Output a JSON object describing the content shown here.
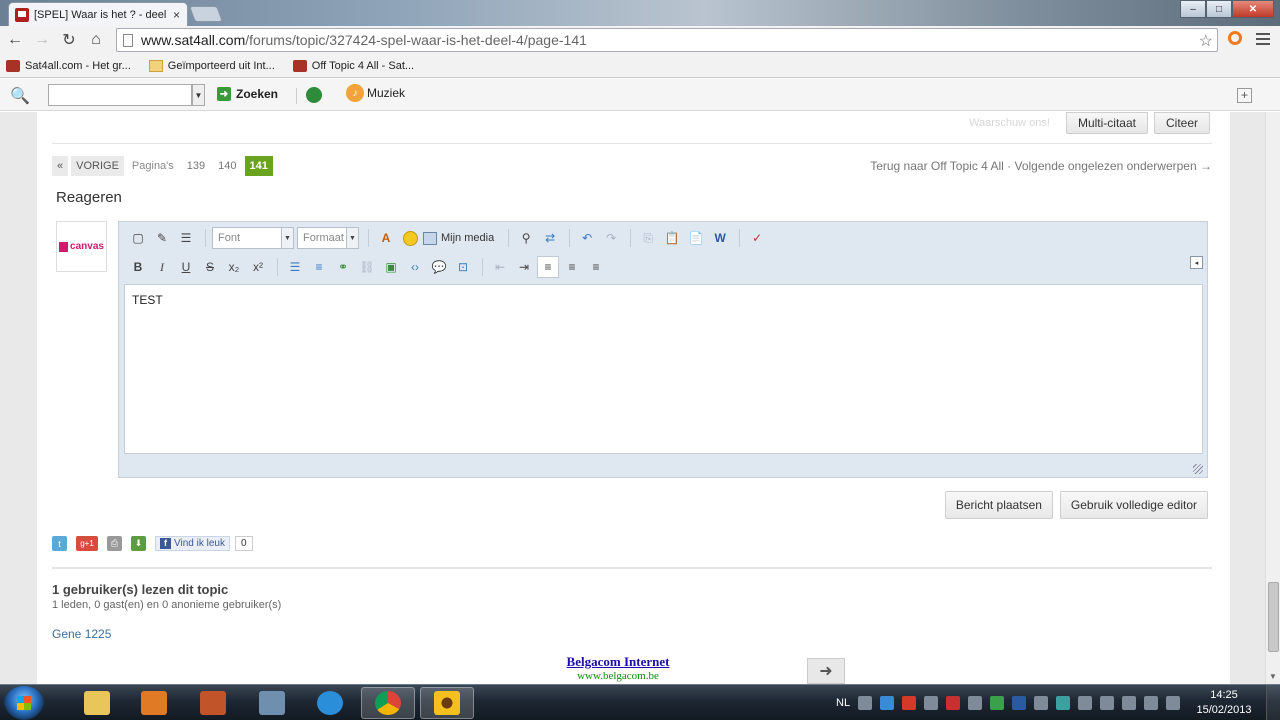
{
  "browser": {
    "tab_title": "[SPEL] Waar is het ? - deel",
    "tab_close": "×",
    "url_domain": "www.sat4all.com",
    "url_path": "/forums/topic/327424-spel-waar-is-het-deel-4/page-141",
    "window_controls": {
      "minimize": "–",
      "maximize": "□",
      "close": "✕"
    },
    "nav": {
      "back": "←",
      "forward": "→",
      "reload": "↻",
      "home": "⌂",
      "star": "☆"
    },
    "bookmarks": [
      {
        "label": "Sat4all.com - Het gr...",
        "icon": "red-tv-icon"
      },
      {
        "label": "Geïmporteerd uit Int...",
        "icon": "folder-icon"
      },
      {
        "label": "Off Topic 4 All - Sat...",
        "icon": "red-tv-icon"
      }
    ]
  },
  "searchbar": {
    "search_icon": "🔍",
    "dropdown": "▼",
    "zoeken_label": "Zoeken",
    "zoeken_arrow": "➜",
    "muziek_label": "Muziek",
    "plus": "+"
  },
  "post_actions": {
    "warn": "Waarschuw ons!",
    "multi_quote": "Multi-citaat",
    "quote": "Citeer"
  },
  "pagination": {
    "first": "«",
    "prev": "VORIGE",
    "pages_label": "Pagina's",
    "pages": [
      "139",
      "140"
    ],
    "current": "141"
  },
  "topic_nav": "Terug naar Off Topic 4 All · Volgende ongelezen onderwerpen →",
  "reply": {
    "heading": "Reageren",
    "avatar_text": "canvas",
    "font_select": "Font",
    "format_select": "Formaat",
    "mijn_media": "Mijn media",
    "text": "TEST",
    "submit": "Bericht plaatsen",
    "full_editor": "Gebruik volledige editor",
    "toolbar_row1": {
      "source": "▢",
      "eraser": "✎",
      "template": "☰",
      "font_color": "A",
      "smiley": "",
      "binoculars": "⚲",
      "replace": "⇄",
      "undo": "↶",
      "redo": "↷",
      "copy": "⎘",
      "paste": "📋",
      "paste_text": "📄",
      "paste_word": "W",
      "spellcheck": "✓"
    },
    "toolbar_row2": {
      "bold": "B",
      "italic": "I",
      "underline": "U",
      "strike": "S",
      "subscript": "x₂",
      "superscript": "x²",
      "bullets": "☰",
      "numbered": "≡",
      "link": "⚭",
      "unlink": "⛓",
      "image": "▣",
      "code": "‹›",
      "quote": "💬",
      "special": "⊡",
      "outdent": "⇤",
      "indent": "⇥",
      "align_left": "≡",
      "align_center": "≡",
      "align_right": "≡"
    },
    "collapse": "◂"
  },
  "social": {
    "twitter": "t",
    "gplus": "g+1",
    "facebook_like": "Vind ik leuk",
    "like_count": "0"
  },
  "readers": {
    "title": "1 gebruiker(s) lezen dit topic",
    "subtitle": "1 leden, 0 gast(en) en 0 anonieme gebruiker(s)",
    "user": "Gene 1225"
  },
  "ad": {
    "title": "Belgacom Internet",
    "url": "www.belgacom.be",
    "arrow": "➜"
  },
  "taskbar": {
    "lang": "NL",
    "time": "14:25",
    "date": "15/02/2013"
  },
  "colors": {
    "pagination_active": "#6aa41f",
    "link": "#3b6fa0",
    "editor_bg": "#dfe8f1"
  }
}
